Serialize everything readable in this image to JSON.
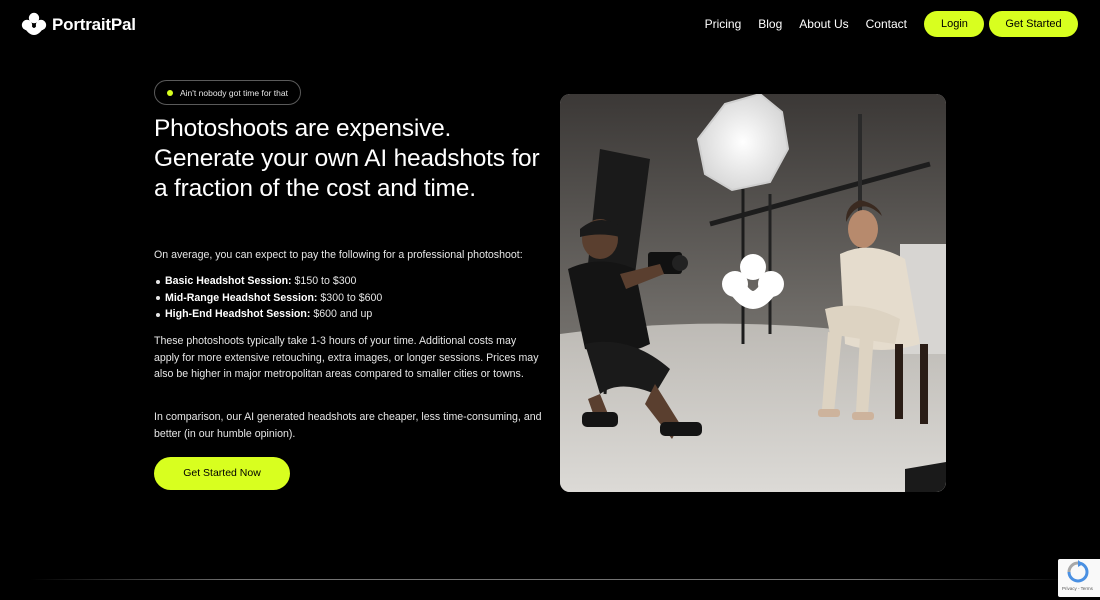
{
  "brand": {
    "name": "PortraitPal",
    "logo_icon": "portraitpal-logo-icon"
  },
  "nav": {
    "links": [
      "Pricing",
      "Blog",
      "About Us",
      "Contact"
    ],
    "login_label": "Login",
    "get_started_label": "Get Started"
  },
  "colors": {
    "accent": "#d8ff1f",
    "background": "#000000"
  },
  "hero": {
    "badge": "Ain't nobody got time for that",
    "headline": "Photoshoots are expensive. Generate your own AI headshots for a fraction of the cost and time.",
    "intro": "On average, you can expect to pay the following for a professional photoshoot:",
    "prices": [
      {
        "label": "Basic Headshot Session:",
        "value": "$150 to $300"
      },
      {
        "label": "Mid-Range Headshot Session:",
        "value": "$300 to $600"
      },
      {
        "label": "High-End Headshot Session:",
        "value": "$600 and up"
      }
    ],
    "paragraph_time": "These photoshoots typically take 1-3 hours of your time. Additional costs may apply for more extensive retouching, extra images, or longer sessions. Prices may also be higher in major metropolitan areas compared to smaller cities or towns.",
    "paragraph_comparison": "In comparison, our AI generated headshots are cheaper, less time-consuming, and better (in our humble opinion).",
    "cta_label": "Get Started Now"
  },
  "recaptcha": {
    "label": "Privacy - Terms"
  }
}
